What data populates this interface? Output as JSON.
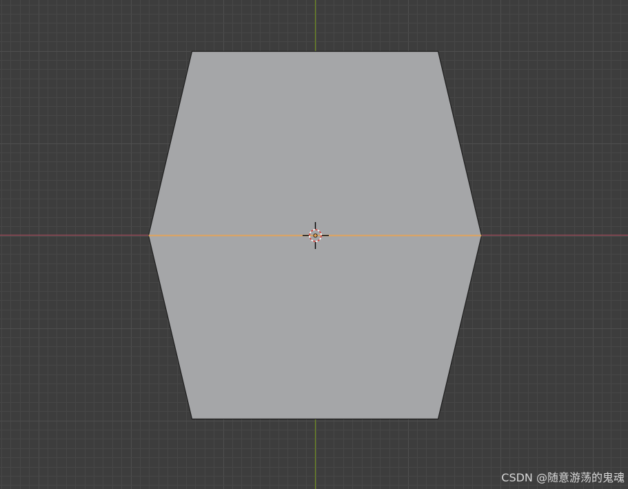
{
  "viewport": {
    "background_color": "#3d3d3d",
    "grid_minor_color": "#474747",
    "grid_major_color": "#4f4f4f",
    "x_axis_color": "#a1485a",
    "y_axis_color": "#6b8a1e",
    "mesh_face_color": "#a5a6a8",
    "mesh_outline_color": "#1e1e1e",
    "selected_edge_color": "#e3a45a",
    "cursor_icon": "3d-cursor-icon",
    "origin_icon": "object-origin-icon"
  },
  "watermark": {
    "text": "CSDN @随意游荡的鬼魂"
  }
}
